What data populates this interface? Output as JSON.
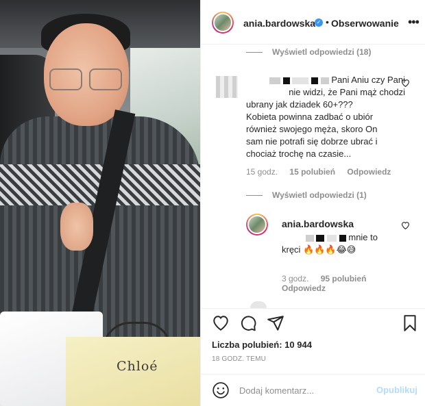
{
  "post": {
    "photo_brand_text": "Chloé"
  },
  "header": {
    "username": "ania.bardowska",
    "separator": "•",
    "follow_label": "Obserwowanie",
    "more_icon": "more-horizontal-icon"
  },
  "comments": {
    "view_replies_top": "Wyświetl odpowiedzi (18)",
    "comment1": {
      "line1": "Pani Aniu czy Pani",
      "line2": "nie widzi, że Pani mąż chodzi",
      "line3": "ubrany jak dziadek 60+???",
      "line4": "Kobieta powinna zadbać o ubiór",
      "line5": "również swojego męża, skoro On",
      "line6": "sam nie potrafi się dobrze ubrać i",
      "line7": "chociaż trochę na czasie...",
      "time": "15 godz.",
      "likes": "15 polubień",
      "reply": "Odpowiedz"
    },
    "view_replies_second": "Wyświetl odpowiedzi (1)",
    "reply1": {
      "username": "ania.bardowska",
      "text_part1": "mnie to",
      "text_part2": "kręci 🔥🔥🔥😂😅",
      "time": "3 godz.",
      "likes": "95 polubień",
      "reply": "Odpowiedz"
    }
  },
  "actions": {
    "likes_text": "Liczba polubień: 10 944",
    "timestamp": "18 GODZ. TEMU"
  },
  "add_comment": {
    "placeholder": "Dodaj komentarz...",
    "publish_label": "Opublikuj"
  },
  "colors": {
    "link_blue": "#3897f0",
    "publish_disabled": "#b3dbff",
    "muted_text": "#8e8e8e"
  }
}
